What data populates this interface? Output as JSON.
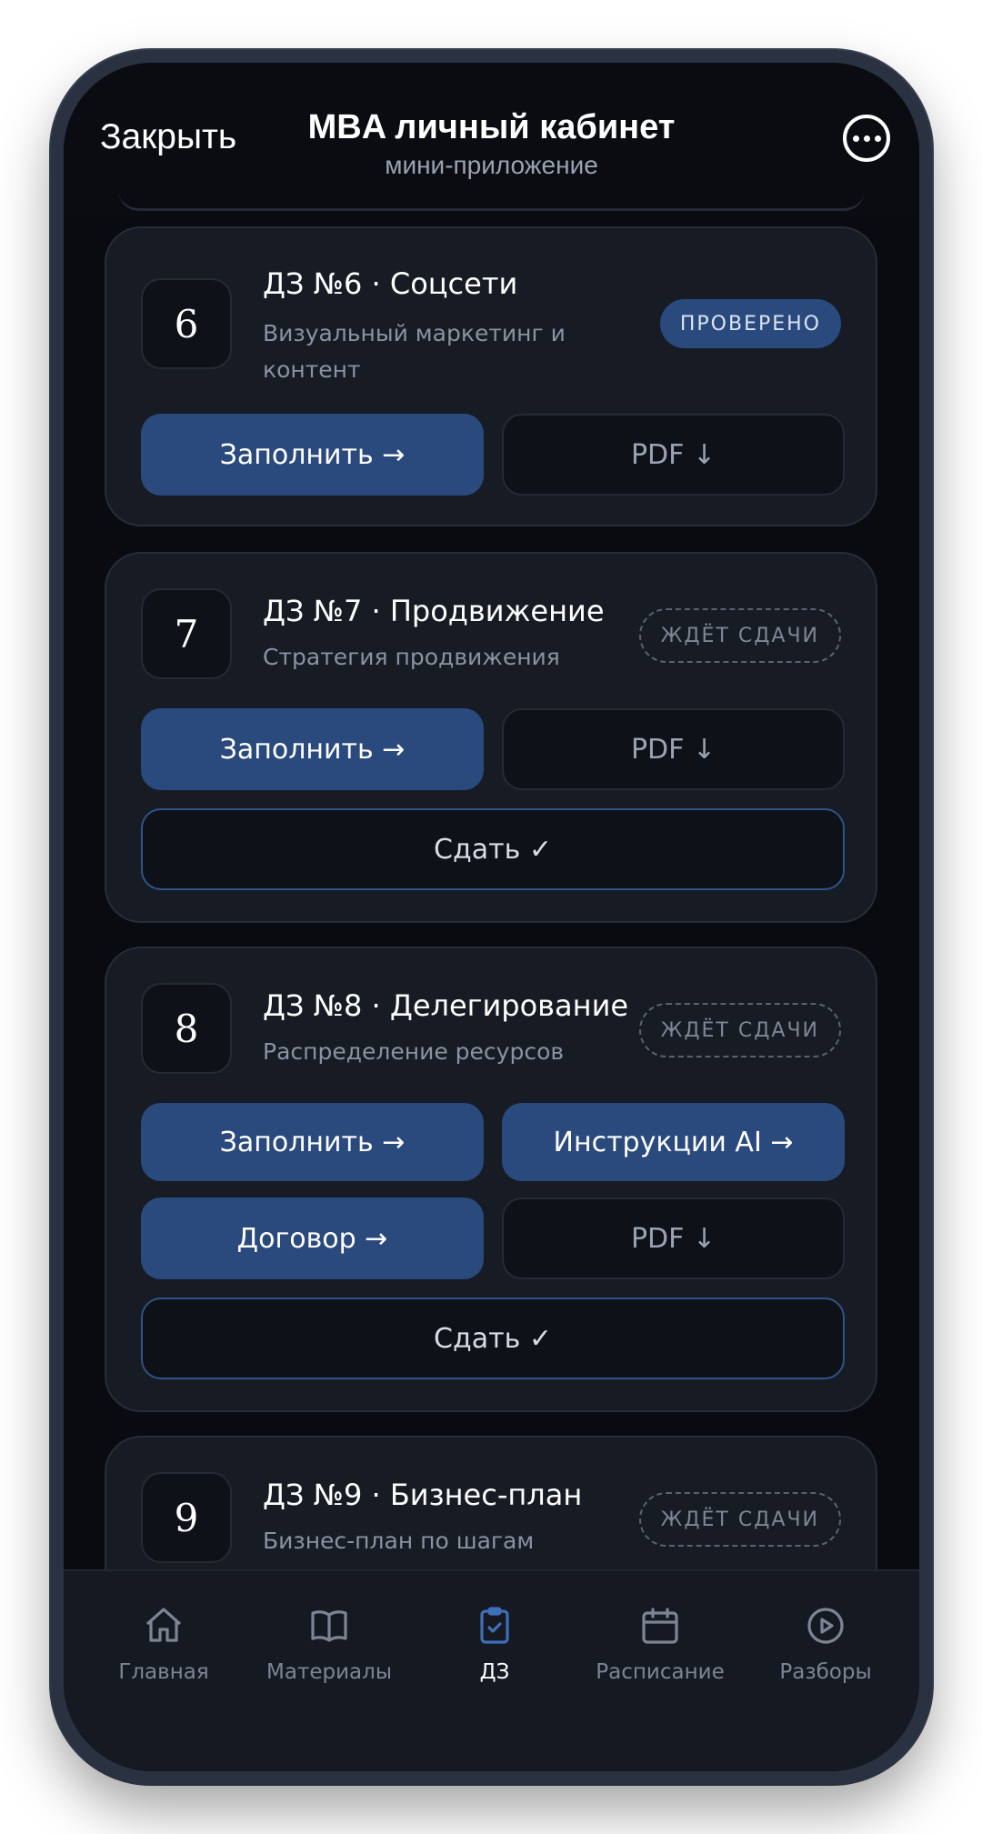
{
  "header": {
    "close_label": "Закрыть",
    "title": "MBA личный кабинет",
    "subtitle": "мини-приложение",
    "more_icon": "more-horizontal-icon"
  },
  "cards": [
    {
      "number": "6",
      "title": "ДЗ №6 · Соцсети",
      "subtitle": "Визуальный маркетинг и контент",
      "status": "ПРОВЕРЕНО",
      "buttons": {
        "fill": "Заполнить →",
        "pdf": "PDF ↓"
      }
    },
    {
      "number": "7",
      "title": "ДЗ №7 · Продвижение",
      "subtitle": "Стратегия продвижения",
      "status": "ЖДЁТ СДАЧИ",
      "buttons": {
        "fill": "Заполнить →",
        "pdf": "PDF ↓",
        "submit": "Сдать ✓"
      }
    },
    {
      "number": "8",
      "title": "ДЗ №8 · Делегирование",
      "subtitle": "Распределение ресурсов",
      "status": "ЖДЁТ СДАЧИ",
      "buttons": {
        "fill": "Заполнить →",
        "ai": "Инструкции AI →",
        "contract": "Договор →",
        "pdf": "PDF ↓",
        "submit": "Сдать ✓"
      }
    },
    {
      "number": "9",
      "title": "ДЗ №9 · Бизнес-план",
      "subtitle": "Бизнес-план по шагам",
      "status": "ЖДЁТ СДАЧИ"
    }
  ],
  "nav": [
    {
      "label": "Главная",
      "icon": "home-icon",
      "active": false
    },
    {
      "label": "Материалы",
      "icon": "book-icon",
      "active": false
    },
    {
      "label": "ДЗ",
      "icon": "clipboard-check-icon",
      "active": true
    },
    {
      "label": "Расписание",
      "icon": "calendar-icon",
      "active": false
    },
    {
      "label": "Разборы",
      "icon": "play-circle-icon",
      "active": false
    }
  ],
  "colors": {
    "accent": "#2a4a7d",
    "background": "#090b10",
    "card": "#171b24",
    "active_nav_icon": "#3f6fb8"
  }
}
